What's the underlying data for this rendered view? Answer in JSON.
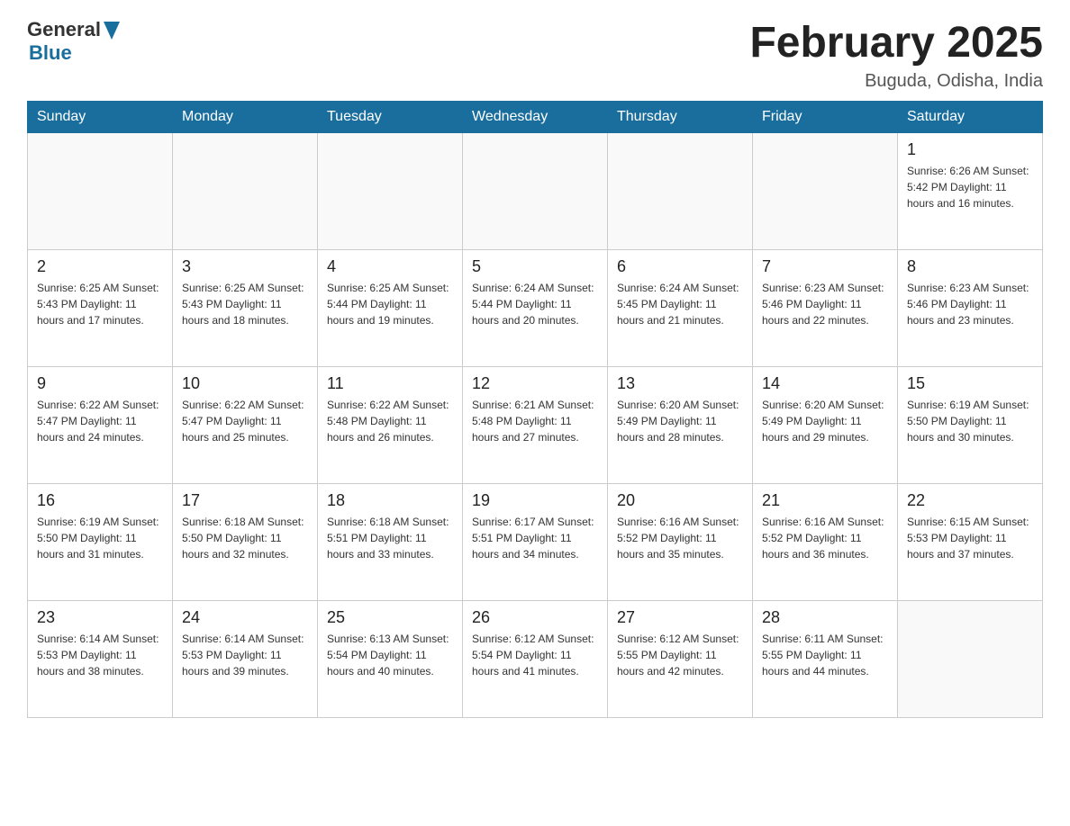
{
  "header": {
    "logo_general": "General",
    "logo_blue": "Blue",
    "title": "February 2025",
    "subtitle": "Buguda, Odisha, India"
  },
  "weekdays": [
    "Sunday",
    "Monday",
    "Tuesday",
    "Wednesday",
    "Thursday",
    "Friday",
    "Saturday"
  ],
  "weeks": [
    [
      {
        "day": "",
        "info": ""
      },
      {
        "day": "",
        "info": ""
      },
      {
        "day": "",
        "info": ""
      },
      {
        "day": "",
        "info": ""
      },
      {
        "day": "",
        "info": ""
      },
      {
        "day": "",
        "info": ""
      },
      {
        "day": "1",
        "info": "Sunrise: 6:26 AM\nSunset: 5:42 PM\nDaylight: 11 hours and 16 minutes."
      }
    ],
    [
      {
        "day": "2",
        "info": "Sunrise: 6:25 AM\nSunset: 5:43 PM\nDaylight: 11 hours and 17 minutes."
      },
      {
        "day": "3",
        "info": "Sunrise: 6:25 AM\nSunset: 5:43 PM\nDaylight: 11 hours and 18 minutes."
      },
      {
        "day": "4",
        "info": "Sunrise: 6:25 AM\nSunset: 5:44 PM\nDaylight: 11 hours and 19 minutes."
      },
      {
        "day": "5",
        "info": "Sunrise: 6:24 AM\nSunset: 5:44 PM\nDaylight: 11 hours and 20 minutes."
      },
      {
        "day": "6",
        "info": "Sunrise: 6:24 AM\nSunset: 5:45 PM\nDaylight: 11 hours and 21 minutes."
      },
      {
        "day": "7",
        "info": "Sunrise: 6:23 AM\nSunset: 5:46 PM\nDaylight: 11 hours and 22 minutes."
      },
      {
        "day": "8",
        "info": "Sunrise: 6:23 AM\nSunset: 5:46 PM\nDaylight: 11 hours and 23 minutes."
      }
    ],
    [
      {
        "day": "9",
        "info": "Sunrise: 6:22 AM\nSunset: 5:47 PM\nDaylight: 11 hours and 24 minutes."
      },
      {
        "day": "10",
        "info": "Sunrise: 6:22 AM\nSunset: 5:47 PM\nDaylight: 11 hours and 25 minutes."
      },
      {
        "day": "11",
        "info": "Sunrise: 6:22 AM\nSunset: 5:48 PM\nDaylight: 11 hours and 26 minutes."
      },
      {
        "day": "12",
        "info": "Sunrise: 6:21 AM\nSunset: 5:48 PM\nDaylight: 11 hours and 27 minutes."
      },
      {
        "day": "13",
        "info": "Sunrise: 6:20 AM\nSunset: 5:49 PM\nDaylight: 11 hours and 28 minutes."
      },
      {
        "day": "14",
        "info": "Sunrise: 6:20 AM\nSunset: 5:49 PM\nDaylight: 11 hours and 29 minutes."
      },
      {
        "day": "15",
        "info": "Sunrise: 6:19 AM\nSunset: 5:50 PM\nDaylight: 11 hours and 30 minutes."
      }
    ],
    [
      {
        "day": "16",
        "info": "Sunrise: 6:19 AM\nSunset: 5:50 PM\nDaylight: 11 hours and 31 minutes."
      },
      {
        "day": "17",
        "info": "Sunrise: 6:18 AM\nSunset: 5:50 PM\nDaylight: 11 hours and 32 minutes."
      },
      {
        "day": "18",
        "info": "Sunrise: 6:18 AM\nSunset: 5:51 PM\nDaylight: 11 hours and 33 minutes."
      },
      {
        "day": "19",
        "info": "Sunrise: 6:17 AM\nSunset: 5:51 PM\nDaylight: 11 hours and 34 minutes."
      },
      {
        "day": "20",
        "info": "Sunrise: 6:16 AM\nSunset: 5:52 PM\nDaylight: 11 hours and 35 minutes."
      },
      {
        "day": "21",
        "info": "Sunrise: 6:16 AM\nSunset: 5:52 PM\nDaylight: 11 hours and 36 minutes."
      },
      {
        "day": "22",
        "info": "Sunrise: 6:15 AM\nSunset: 5:53 PM\nDaylight: 11 hours and 37 minutes."
      }
    ],
    [
      {
        "day": "23",
        "info": "Sunrise: 6:14 AM\nSunset: 5:53 PM\nDaylight: 11 hours and 38 minutes."
      },
      {
        "day": "24",
        "info": "Sunrise: 6:14 AM\nSunset: 5:53 PM\nDaylight: 11 hours and 39 minutes."
      },
      {
        "day": "25",
        "info": "Sunrise: 6:13 AM\nSunset: 5:54 PM\nDaylight: 11 hours and 40 minutes."
      },
      {
        "day": "26",
        "info": "Sunrise: 6:12 AM\nSunset: 5:54 PM\nDaylight: 11 hours and 41 minutes."
      },
      {
        "day": "27",
        "info": "Sunrise: 6:12 AM\nSunset: 5:55 PM\nDaylight: 11 hours and 42 minutes."
      },
      {
        "day": "28",
        "info": "Sunrise: 6:11 AM\nSunset: 5:55 PM\nDaylight: 11 hours and 44 minutes."
      },
      {
        "day": "",
        "info": ""
      }
    ]
  ]
}
